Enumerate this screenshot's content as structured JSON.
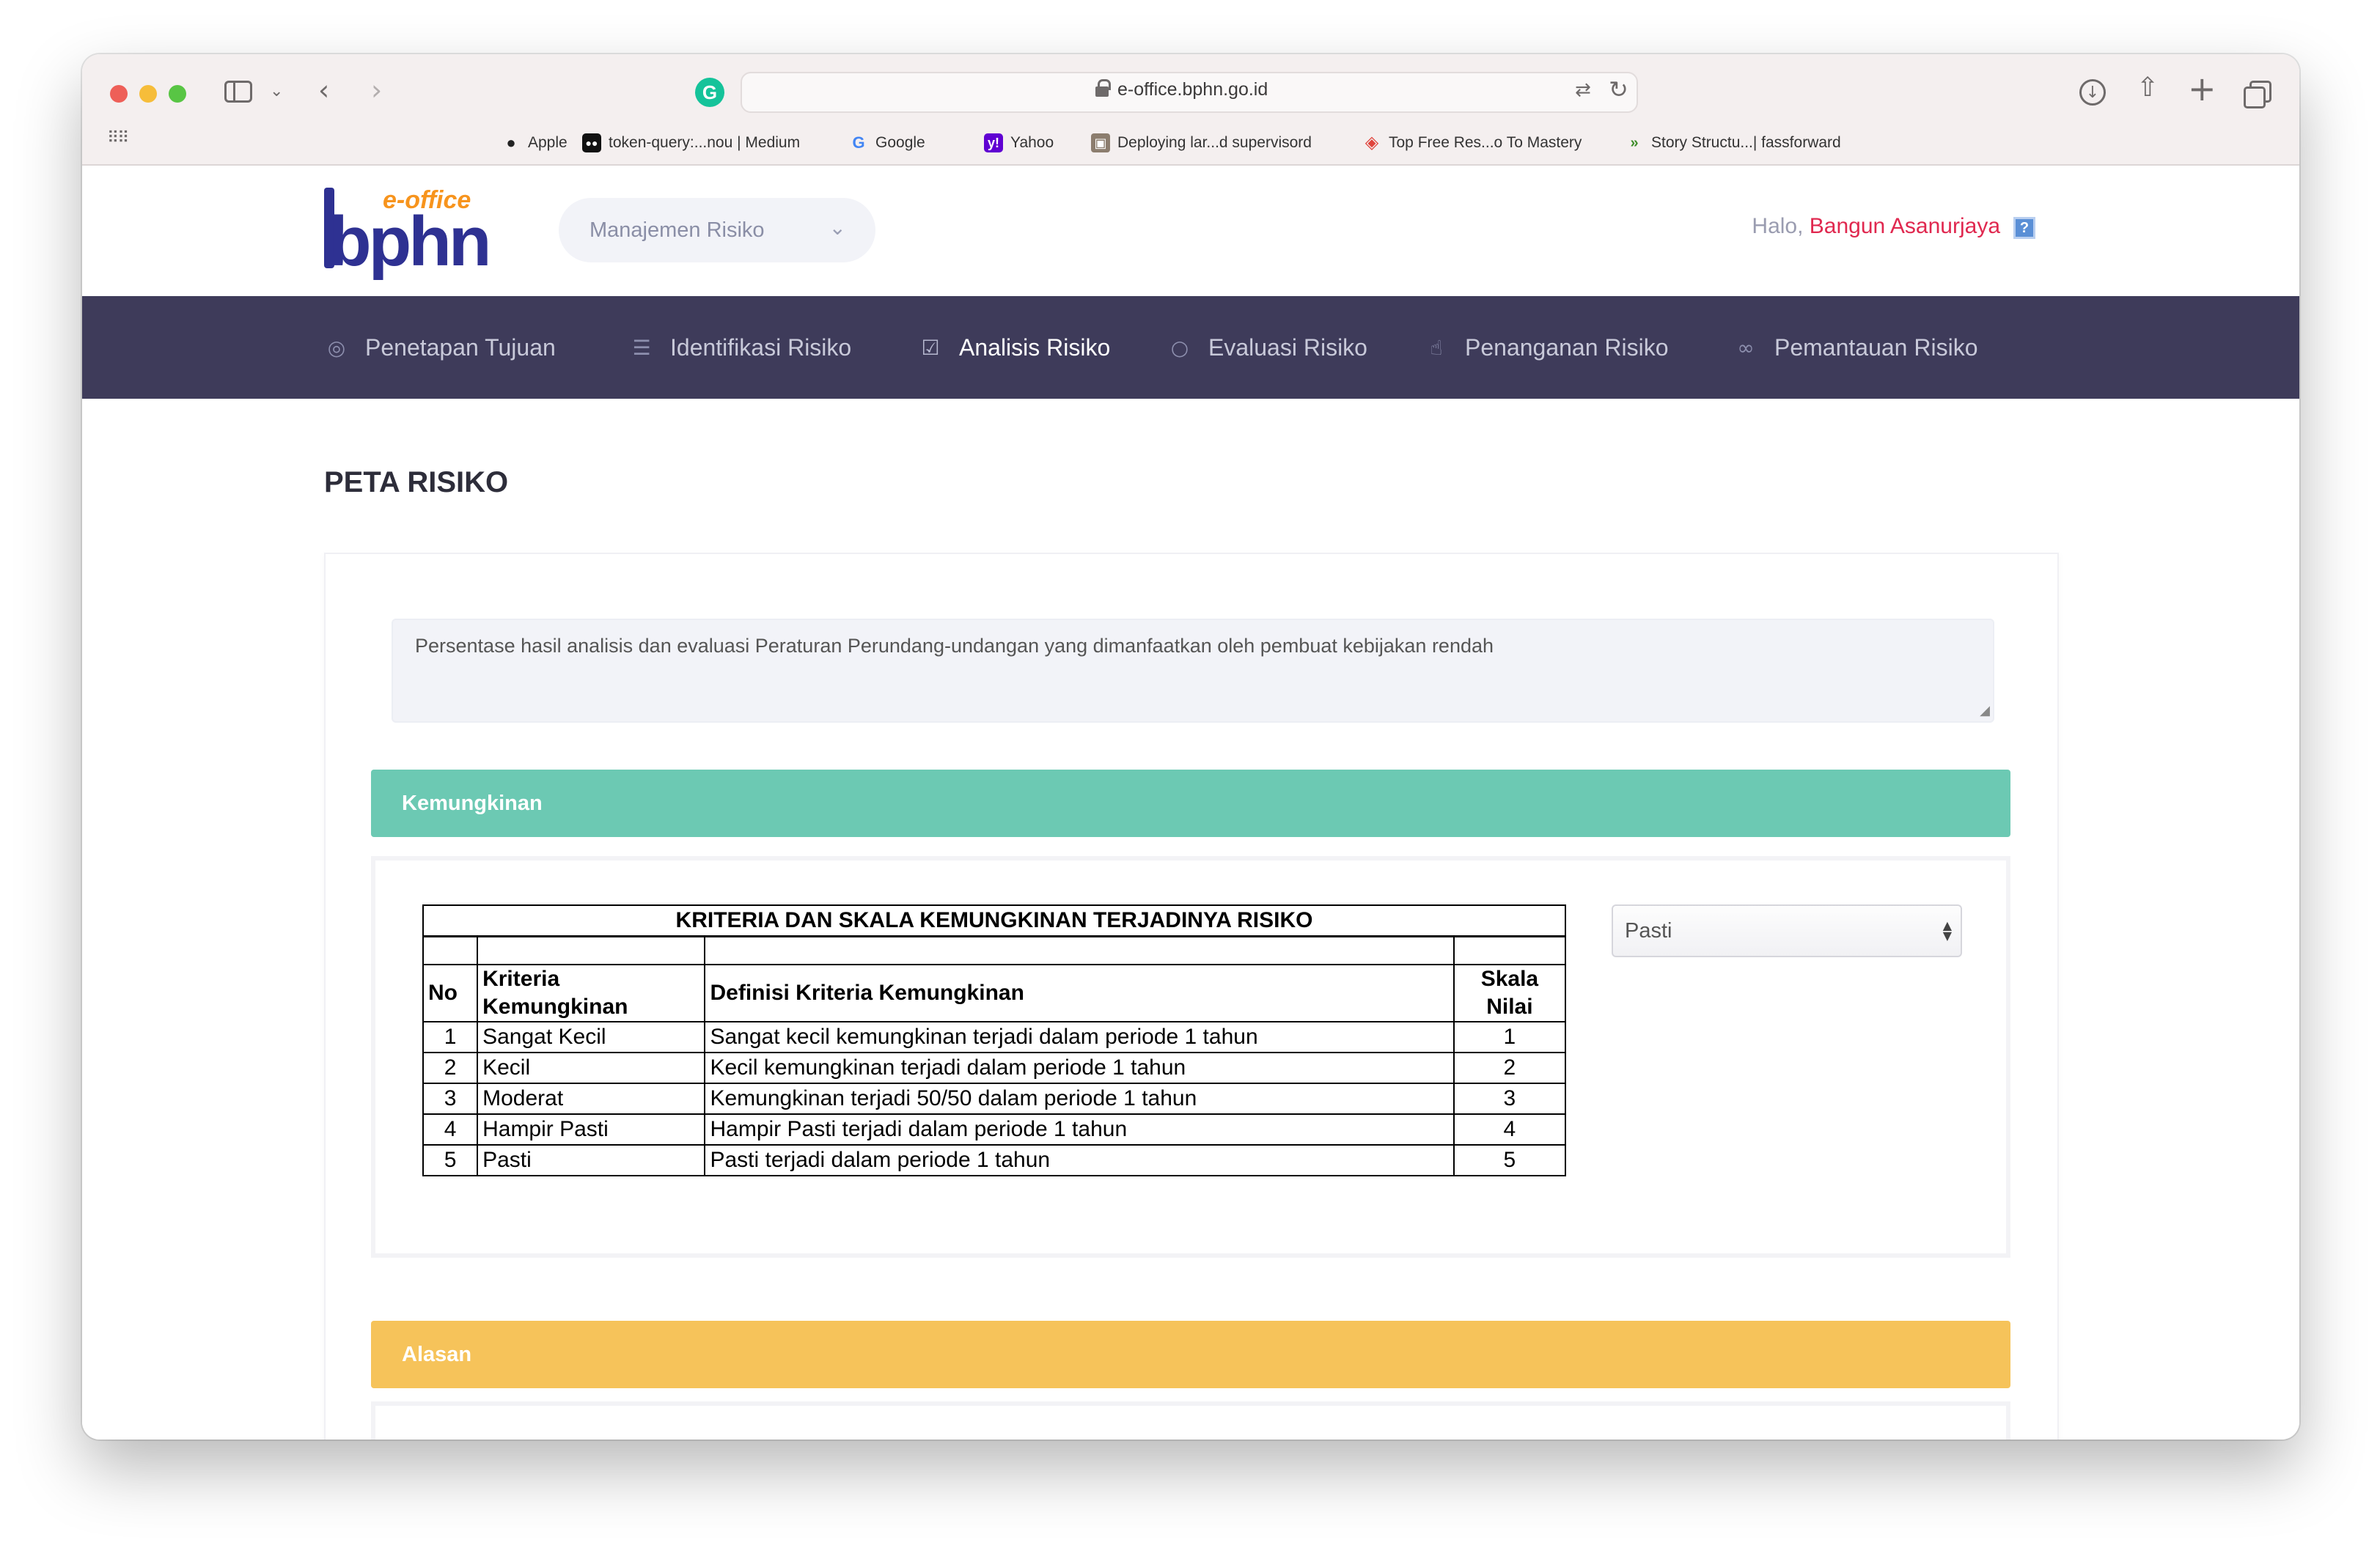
{
  "browser": {
    "url": "e-office.bphn.go.id",
    "bookmarks": [
      {
        "label": "Apple",
        "icon": "apple-icon"
      },
      {
        "label": "token-query:...nou | Medium",
        "icon": "medium-icon"
      },
      {
        "label": "Google",
        "icon": "google-icon"
      },
      {
        "label": "Yahoo",
        "icon": "yahoo-icon"
      },
      {
        "label": "Deploying lar...d supervisord",
        "icon": "deploy-icon"
      },
      {
        "label": "Top Free Res...o To Mastery",
        "icon": "ztm-icon"
      },
      {
        "label": "Story Structu...| fassforward",
        "icon": "fassforward-icon"
      }
    ]
  },
  "header": {
    "logo_top": "e-office",
    "logo_main": "bphn",
    "module_select": "Manajemen Risiko",
    "greeting_prefix": "Halo,",
    "user_name": "Bangun Asanurjaya",
    "help_label": "?"
  },
  "nav": {
    "items": [
      {
        "label": "Penetapan Tujuan",
        "icon": "target-icon"
      },
      {
        "label": "Identifikasi Risiko",
        "icon": "list-icon"
      },
      {
        "label": "Analisis Risiko",
        "icon": "checkbox-icon",
        "active": true
      },
      {
        "label": "Evaluasi Risiko",
        "icon": "circle-icon"
      },
      {
        "label": "Penanganan Risiko",
        "icon": "thumbs-up-icon"
      },
      {
        "label": "Pemantauan Risiko",
        "icon": "binoculars-icon"
      }
    ]
  },
  "page": {
    "title": "PETA RISIKO",
    "description": "Persentase hasil analisis dan evaluasi Peraturan Perundang-undangan yang dimanfaatkan oleh pembuat kebijakan rendah"
  },
  "kemungkinan": {
    "section_title": "Kemungkinan",
    "table": {
      "title": "KRITERIA DAN SKALA KEMUNGKINAN TERJADINYA RISIKO",
      "headers": {
        "no": "No",
        "kriteria": "Kriteria Kemungkinan",
        "definisi": "Definisi Kriteria Kemungkinan",
        "skala": "Skala Nilai"
      },
      "rows": [
        {
          "no": "1",
          "kriteria": "Sangat Kecil",
          "definisi": "Sangat kecil kemungkinan terjadi dalam periode 1 tahun",
          "skala": "1"
        },
        {
          "no": "2",
          "kriteria": "Kecil",
          "definisi": "Kecil kemungkinan terjadi dalam periode 1 tahun",
          "skala": "2"
        },
        {
          "no": "3",
          "kriteria": "Moderat",
          "definisi": "Kemungkinan terjadi 50/50 dalam periode 1 tahun",
          "skala": "3"
        },
        {
          "no": "4",
          "kriteria": "Hampir Pasti",
          "definisi": "Hampir Pasti terjadi dalam periode 1 tahun",
          "skala": "4"
        },
        {
          "no": "5",
          "kriteria": "Pasti",
          "definisi": "Pasti terjadi dalam periode 1 tahun",
          "skala": "5"
        }
      ]
    },
    "selected_value": "Pasti"
  },
  "alasan": {
    "section_title": "Alasan"
  },
  "colors": {
    "nav_bg": "#3e3b5a",
    "kemungkinan_bar": "#6cc9b3",
    "alasan_bar": "#f6c35a",
    "user_name": "#e0284f"
  }
}
